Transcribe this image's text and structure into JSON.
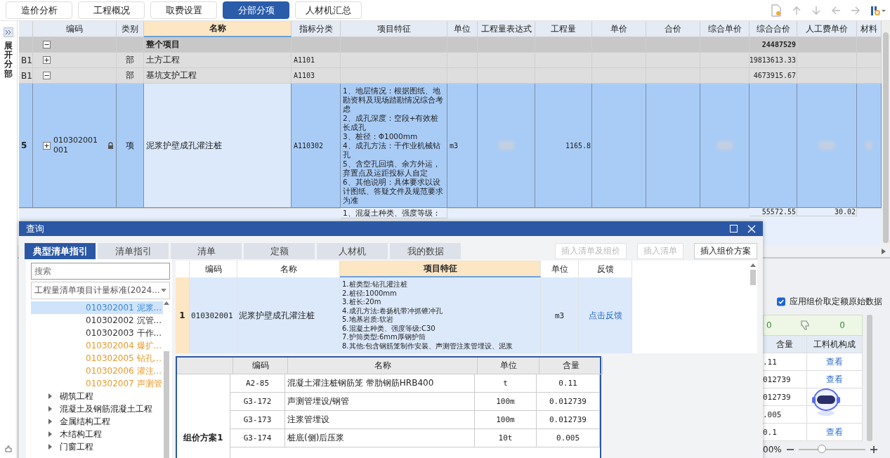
{
  "top_tabs": [
    {
      "label": "造价分析",
      "selected": false
    },
    {
      "label": "工程概况",
      "selected": false
    },
    {
      "label": "取费设置",
      "selected": false
    },
    {
      "label": "分部分项",
      "selected": true
    },
    {
      "label": "人材机汇总",
      "selected": false
    }
  ],
  "side": {
    "label": "展开分部"
  },
  "main_table": {
    "columns": [
      {
        "label": "编码",
        "highlighted": false
      },
      {
        "label": "类别",
        "highlighted": false
      },
      {
        "label": "名称",
        "highlighted": true
      },
      {
        "label": "指标分类",
        "highlighted": false
      },
      {
        "label": "项目特征",
        "highlighted": false
      },
      {
        "label": "单位",
        "highlighted": false
      },
      {
        "label": "工程量表达式",
        "highlighted": false
      },
      {
        "label": "工程量",
        "highlighted": false
      },
      {
        "label": "单价",
        "highlighted": false
      },
      {
        "label": "合价",
        "highlighted": false
      },
      {
        "label": "综合单价",
        "highlighted": false
      },
      {
        "label": "综合合价",
        "highlighted": false
      },
      {
        "label": "人工费单价",
        "highlighted": false
      },
      {
        "label": "材料",
        "highlighted": false
      }
    ],
    "rows": [
      {
        "kind": "root",
        "expanded": true,
        "name": "整个项目",
        "total": "24487529",
        "selected": false
      },
      {
        "kind": "section",
        "row_no": "B1",
        "expanded": false,
        "type": "部",
        "name": "土方工程",
        "index_class": "A1101",
        "total": "19813613.33",
        "selected": false
      },
      {
        "kind": "section",
        "row_no": "B1",
        "expanded": true,
        "type": "部",
        "name": "基坑支护工程",
        "index_class": "A1103",
        "total": "4673915.67",
        "selected": false
      },
      {
        "kind": "item",
        "row_no": "5",
        "expanded": false,
        "code": "010302001001",
        "locked": true,
        "type": "项",
        "name": "泥浆护壁成孔灌注桩",
        "index_class": "A110302",
        "features": [
          "1、地层情况：根据图纸、地勘资料及现场踏勘情况综合考虑",
          "2、成孔深度：空段+有效桩长成孔",
          "3、桩径：Φ1000mm",
          "4、成孔方法：干作业机械钻孔",
          "5、含空孔回填、余方外运，弃置点及运距投标人自定",
          "6、其他说明：具体要求以设计图纸、答疑文件及规范要求为准"
        ],
        "unit": "m3",
        "quantity": "1165.8",
        "redacted": true,
        "selected": true
      },
      {
        "kind": "partial",
        "features": [
          "1、混凝土种类、强度等级："
        ],
        "total": "55572.55",
        "labor_price": "30.02",
        "selected": false
      }
    ]
  },
  "dialog": {
    "title": "查询",
    "tabs": [
      {
        "label": "典型清单指引",
        "selected": true
      },
      {
        "label": "清单指引",
        "selected": false
      },
      {
        "label": "清单",
        "selected": false
      },
      {
        "label": "定额",
        "selected": false
      },
      {
        "label": "人材机",
        "selected": false
      },
      {
        "label": "我的数据",
        "selected": false
      }
    ],
    "buttons": [
      {
        "label": "插入清单及组价",
        "disabled": true
      },
      {
        "label": "插入清单",
        "disabled": true
      },
      {
        "label": "插入组价方案",
        "disabled": false
      }
    ],
    "search": {
      "placeholder": "搜索"
    },
    "standard": {
      "value": "工程量清单项目计量标准(2024..."
    },
    "tree": [
      {
        "kind": "leaf",
        "label": "010302001 泥浆...",
        "color": "#3d86d8",
        "selected": true
      },
      {
        "kind": "leaf",
        "label": "010302002 沉管...",
        "color": "#333333",
        "selected": false
      },
      {
        "kind": "leaf",
        "label": "010302003 干作...",
        "color": "#333333",
        "selected": false
      },
      {
        "kind": "leaf",
        "label": "010302004 爆扩...",
        "color": "#e89a2c",
        "selected": false
      },
      {
        "kind": "leaf",
        "label": "010302005 钻孔...",
        "color": "#e89a2c",
        "selected": false
      },
      {
        "kind": "leaf",
        "label": "010302006 灌注...",
        "color": "#e89a2c",
        "selected": false
      },
      {
        "kind": "leaf",
        "label": "010302007 声测管",
        "color": "#e89a2c",
        "selected": false
      },
      {
        "kind": "folder",
        "label": "砌筑工程",
        "expanded": false
      },
      {
        "kind": "folder",
        "label": "混凝土及钢筋混凝土工程",
        "expanded": false
      },
      {
        "kind": "folder",
        "label": "金属结构工程",
        "expanded": false
      },
      {
        "kind": "folder",
        "label": "木结构工程",
        "expanded": false
      },
      {
        "kind": "folder",
        "label": "门窗工程",
        "expanded": false
      }
    ],
    "list_table": {
      "columns": [
        {
          "label": "编码",
          "highlighted": false
        },
        {
          "label": "名称",
          "highlighted": false
        },
        {
          "label": "项目特征",
          "highlighted": true
        },
        {
          "label": "单位",
          "highlighted": false
        },
        {
          "label": "反馈",
          "highlighted": false
        }
      ],
      "rows": [
        {
          "no": "1",
          "code": "010302001",
          "name": "泥浆护壁成孔灌注桩",
          "features": [
            "1.桩类型:钻孔灌注桩",
            "2.桩径:1000mm",
            "3.桩长:20m",
            "4.成孔方法:卷扬机带冲抓锥冲孔",
            "5.地基岩质:软岩",
            "6.混凝土种类、强度等级:C30",
            "7.护筒类型:6mm厚钢护筒",
            "8.其他:包含钢筋笼制作安装、声测管注浆管埋设、泥浆"
          ],
          "unit": "m3",
          "feedback": "点击反馈",
          "selected": true
        }
      ]
    },
    "plan_table": {
      "columns": [
        "编码",
        "名称",
        "单位",
        "含量"
      ],
      "group": "组价方案1",
      "rows": [
        {
          "code": "A2-85",
          "name": "混凝土灌注桩钢筋笼 带肋钢筋HRB400",
          "unit": "t",
          "amount": "0.11"
        },
        {
          "code": "G3-172",
          "name": "声测管埋设/钢管",
          "unit": "100m",
          "amount": "0.012739"
        },
        {
          "code": "G3-173",
          "name": "注浆管埋设",
          "unit": "100m",
          "amount": "0.012739"
        },
        {
          "code": "G3-174",
          "name": "桩底(侧)后压浆",
          "unit": "10t",
          "amount": "0.005"
        }
      ]
    }
  },
  "side_panel": {
    "checkbox": {
      "label": "应用组价取定额原始数据",
      "checked": true
    },
    "votes": {
      "up": "0",
      "down": "0"
    },
    "columns": [
      "含量",
      "工料机构成"
    ],
    "rows": [
      {
        "amount": ".11",
        "link": "查看"
      },
      {
        "amount": "012739",
        "link": "查看"
      },
      {
        "amount": "012739"
      },
      {
        "amount": ".005"
      },
      {
        "amount": "0.1",
        "link": "查看"
      }
    ]
  },
  "zoom": {
    "reading": "00%",
    "level": 0.35
  }
}
